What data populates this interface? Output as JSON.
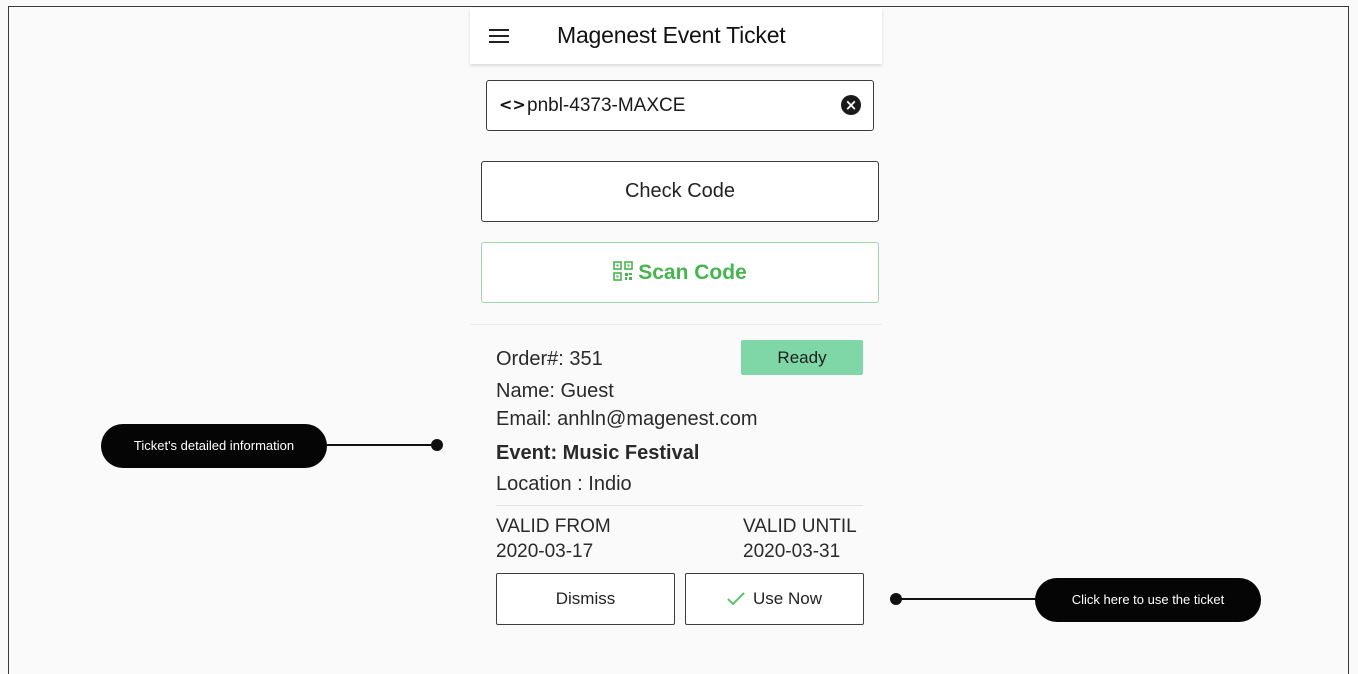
{
  "app": {
    "title": "Magenest Event Ticket"
  },
  "search": {
    "value": "pnbl-4373-MAXCE",
    "placeholder": ""
  },
  "buttons": {
    "check_code": "Check Code",
    "scan_code": "Scan Code",
    "dismiss": "Dismiss",
    "use_now": "Use Now"
  },
  "ticket": {
    "order": "Order#: 351",
    "status": "Ready",
    "name": "Name: Guest",
    "email": "Email: anhln@magenest.com",
    "event": "Event: Music Festival",
    "location": "Location : Indio",
    "valid_from_label": "VALID FROM",
    "valid_from_date": "2020-03-17",
    "valid_until_label": "VALID UNTIL",
    "valid_until_date": "2020-03-31"
  },
  "annotations": {
    "left": "Ticket's detailed information",
    "right": "Click here to use the ticket"
  },
  "colors": {
    "accent_green": "#47b54f",
    "status_green": "#7fd7a7",
    "callout_bg": "#050505"
  },
  "icons": {
    "menu": "hamburger-menu-icon",
    "code": "code-brackets-icon",
    "clear": "clear-circle-icon",
    "scan": "qr-code-icon",
    "check": "checkmark-icon"
  }
}
